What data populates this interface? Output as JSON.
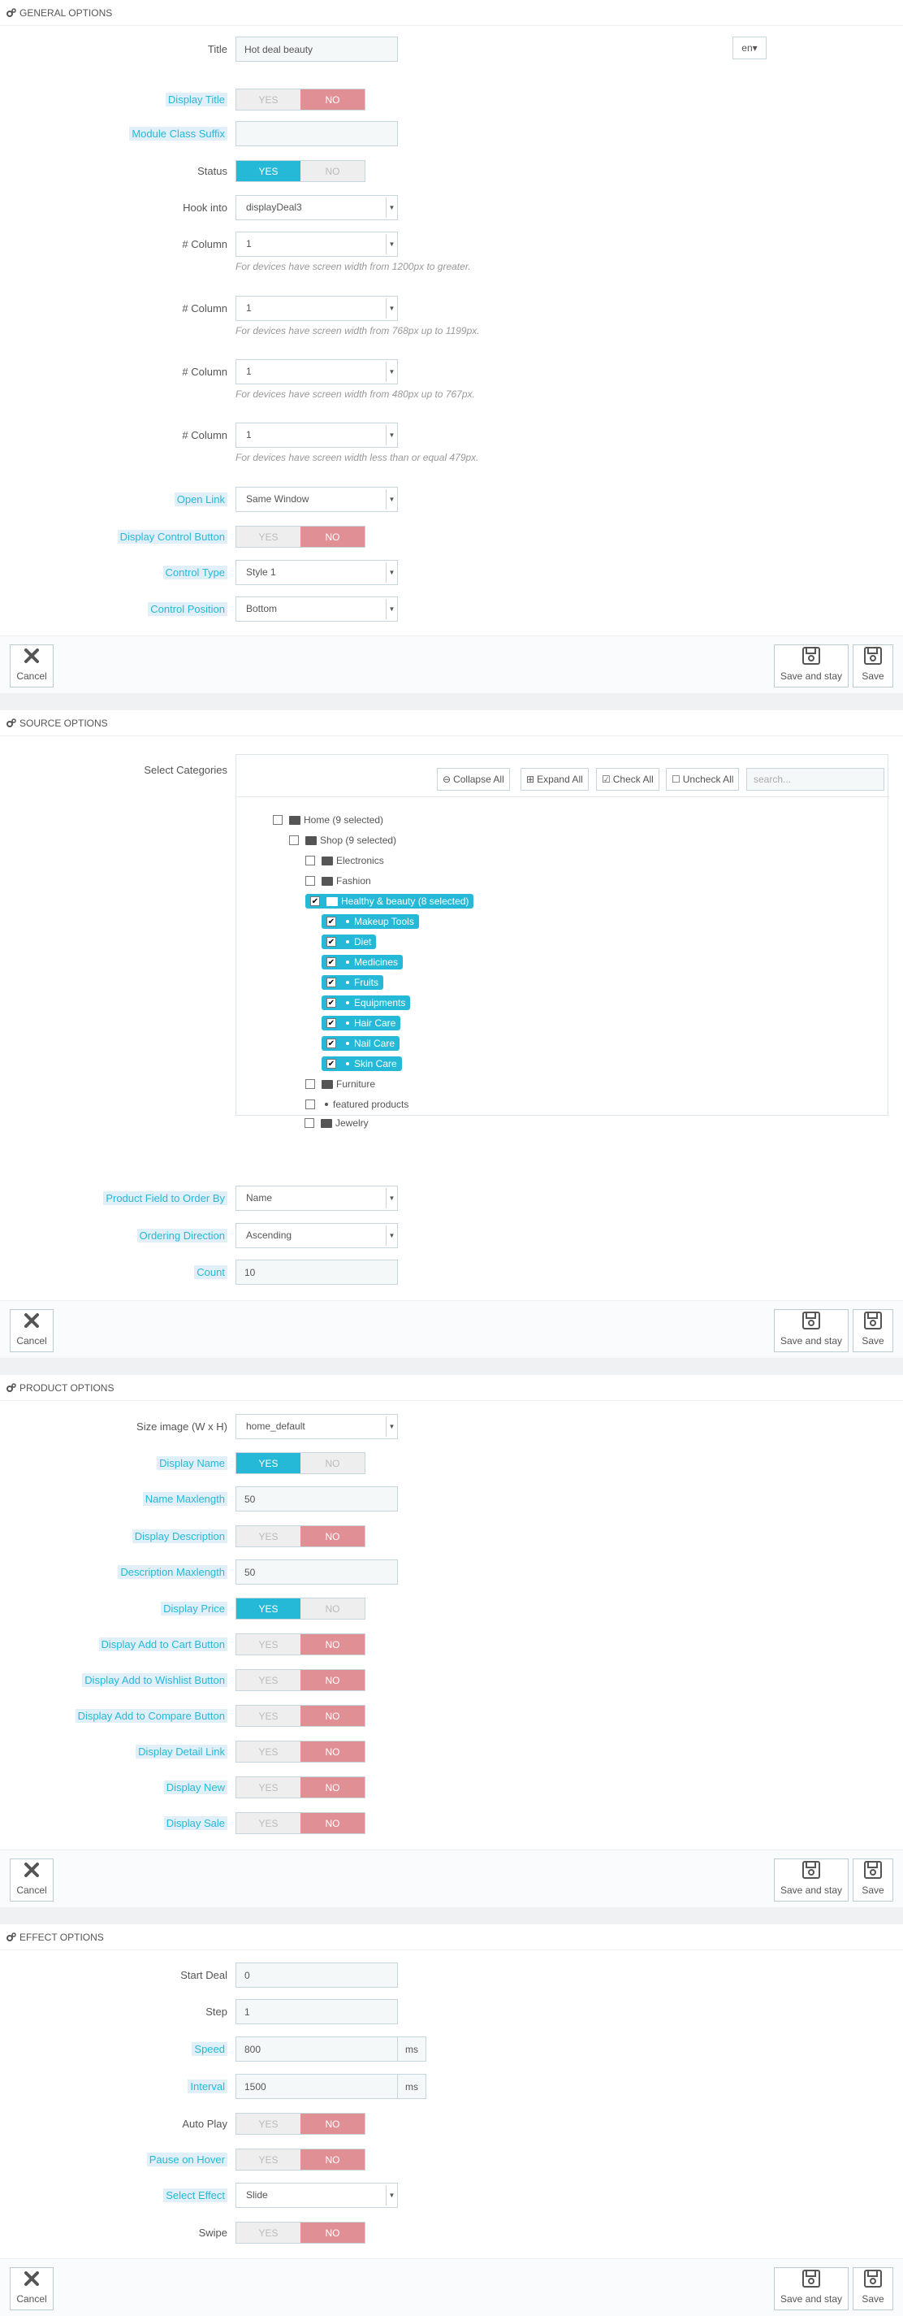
{
  "general": {
    "header": "GENERAL OPTIONS",
    "title_label": "Title",
    "title_value": "Hot deal beauty",
    "lang": "en",
    "display_title_label": "Display Title",
    "module_class_label": "Module Class Suffix",
    "module_class_value": "",
    "status_label": "Status",
    "hook_label": "Hook into",
    "hook_value": "displayDeal3",
    "column_label": "# Column",
    "col1_value": "1",
    "col1_help": "For devices have screen width from 1200px to greater.",
    "col2_value": "1",
    "col2_help": "For devices have screen width from 768px up to 1199px.",
    "col3_value": "1",
    "col3_help": "For devices have screen width from 480px up to 767px.",
    "col4_value": "1",
    "col4_help": "For devices have screen width less than or equal 479px.",
    "open_link_label": "Open Link",
    "open_link_value": "Same Window",
    "display_control_label": "Display Control Button",
    "control_type_label": "Control Type",
    "control_type_value": "Style 1",
    "control_position_label": "Control Position",
    "control_position_value": "Bottom"
  },
  "toggle": {
    "yes": "YES",
    "no": "NO"
  },
  "buttons": {
    "cancel": "Cancel",
    "save_stay": "Save and stay",
    "save": "Save"
  },
  "source": {
    "header": "SOURCE OPTIONS",
    "categories_label": "Select Categories",
    "collapse_all": "Collapse All",
    "expand_all": "Expand All",
    "check_all": "Check All",
    "uncheck_all": "Uncheck All",
    "search_placeholder": "search...",
    "tree": {
      "home": "Home (9 selected)",
      "shop": "Shop (9 selected)",
      "electronics": "Electronics",
      "fashion": "Fashion",
      "healthy": "Healthy & beauty (8 selected)",
      "makeup": "Makeup Tools",
      "diet": "Diet",
      "medicines": "Medicines",
      "fruits": "Fruits",
      "equipments": "Equipments",
      "hair": "Hair Care",
      "nail": "Nail Care",
      "skin": "Skin Care",
      "furniture": "Furniture",
      "featured": "featured products",
      "jewelry": "Jewelry"
    },
    "order_by_label": "Product Field to Order By",
    "order_by_value": "Name",
    "direction_label": "Ordering Direction",
    "direction_value": "Ascending",
    "count_label": "Count",
    "count_value": "10"
  },
  "product": {
    "header": "PRODUCT OPTIONS",
    "size_label": "Size image (W x H)",
    "size_value": "home_default",
    "display_name_label": "Display Name",
    "name_max_label": "Name Maxlength",
    "name_max_value": "50",
    "display_desc_label": "Display Description",
    "desc_max_label": "Description Maxlength",
    "desc_max_value": "50",
    "display_price_label": "Display Price",
    "add_cart_label": "Display Add to Cart Button",
    "add_wishlist_label": "Display Add to Wishlist Button",
    "add_compare_label": "Display Add to Compare Button",
    "detail_link_label": "Display Detail Link",
    "display_new_label": "Display New",
    "display_sale_label": "Display Sale"
  },
  "effect": {
    "header": "EFFECT OPTIONS",
    "start_label": "Start Deal",
    "start_value": "0",
    "step_label": "Step",
    "step_value": "1",
    "speed_label": "Speed",
    "speed_value": "800",
    "interval_label": "Interval",
    "interval_value": "1500",
    "unit": "ms",
    "autoplay_label": "Auto Play",
    "pause_label": "Pause on Hover",
    "effect_label": "Select Effect",
    "effect_value": "Slide",
    "swipe_label": "Swipe"
  },
  "colors": {
    "accent": "#25b9d7",
    "no": "#e08f95",
    "bg": "#eff1f2"
  }
}
